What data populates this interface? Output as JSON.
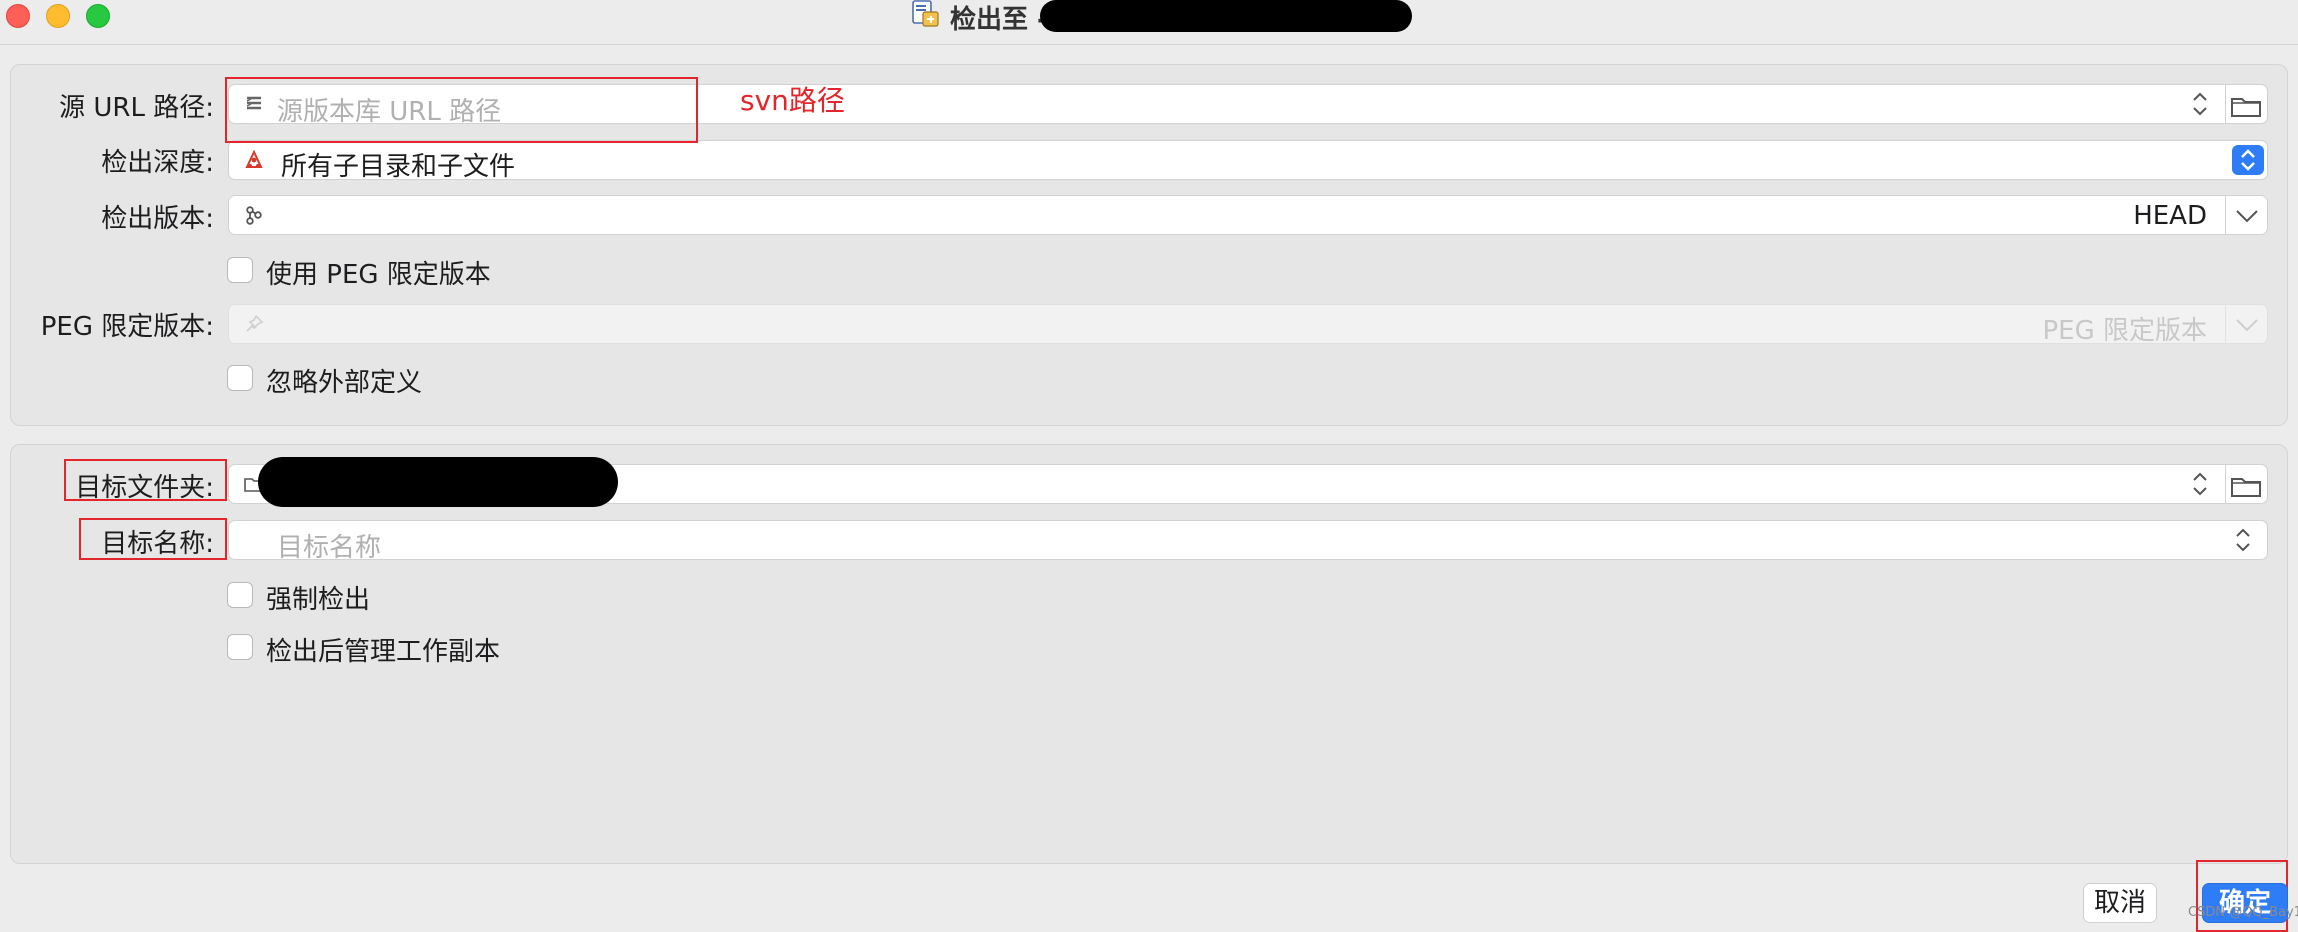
{
  "window": {
    "title": "检出至 -",
    "title_icon": "svn-checkout-icon"
  },
  "source": {
    "url_label": "源 URL 路径:",
    "url_placeholder": "源版本库 URL 路径",
    "depth_label": "检出深度:",
    "depth_value": "所有子目录和子文件",
    "revision_label": "检出版本:",
    "revision_value": "HEAD",
    "use_peg_label": "使用 PEG 限定版本",
    "peg_label": "PEG 限定版本:",
    "peg_placeholder": "PEG 限定版本",
    "ignore_externals_label": "忽略外部定义"
  },
  "target": {
    "folder_label": "目标文件夹:",
    "name_label": "目标名称:",
    "name_placeholder": "目标名称",
    "force_label": "强制检出",
    "manage_label": "检出后管理工作副本"
  },
  "annotation": {
    "svn_note": "svn路径",
    "color": "#e3262b"
  },
  "buttons": {
    "cancel": "取消",
    "ok": "确定"
  },
  "watermark": "CSDN @QQ_Bay11",
  "colors": {
    "accent": "#2f7df6",
    "annotation": "#e3262b"
  }
}
